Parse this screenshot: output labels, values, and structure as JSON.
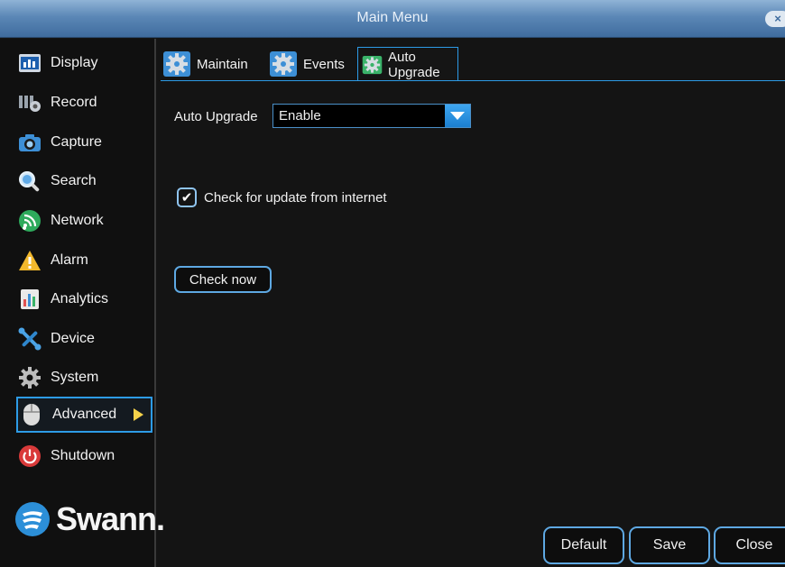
{
  "window": {
    "title": "Main Menu",
    "close_glyph": "×"
  },
  "sidebar": {
    "items": [
      {
        "label": "Display",
        "icon": "display-icon"
      },
      {
        "label": "Record",
        "icon": "record-icon"
      },
      {
        "label": "Capture",
        "icon": "camera-icon"
      },
      {
        "label": "Search",
        "icon": "search-icon"
      },
      {
        "label": "Network",
        "icon": "network-icon"
      },
      {
        "label": "Alarm",
        "icon": "alarm-icon"
      },
      {
        "label": "Analytics",
        "icon": "analytics-icon"
      },
      {
        "label": "Device",
        "icon": "device-icon"
      },
      {
        "label": "System",
        "icon": "gear-icon"
      },
      {
        "label": "Advanced",
        "icon": "mouse-icon",
        "active": true
      },
      {
        "label": "Shutdown",
        "icon": "power-icon"
      }
    ],
    "logo_text": "Swann",
    "logo_mark": "."
  },
  "tabs": [
    {
      "label": "Maintain"
    },
    {
      "label": "Events"
    },
    {
      "label": "Auto Upgrade",
      "active": true
    }
  ],
  "main": {
    "auto_upgrade_label": "Auto Upgrade",
    "auto_upgrade_value": "Enable",
    "check_internet_label": "Check for update from internet",
    "check_internet_checked": true,
    "check_now_label": "Check now"
  },
  "footer": {
    "default_label": "Default",
    "save_label": "Save",
    "close_label": "Close"
  },
  "colors": {
    "accent": "#2d9be6",
    "titlebar": "#5b87b6",
    "background": "#141414",
    "active_arrow": "#f5d24a"
  }
}
